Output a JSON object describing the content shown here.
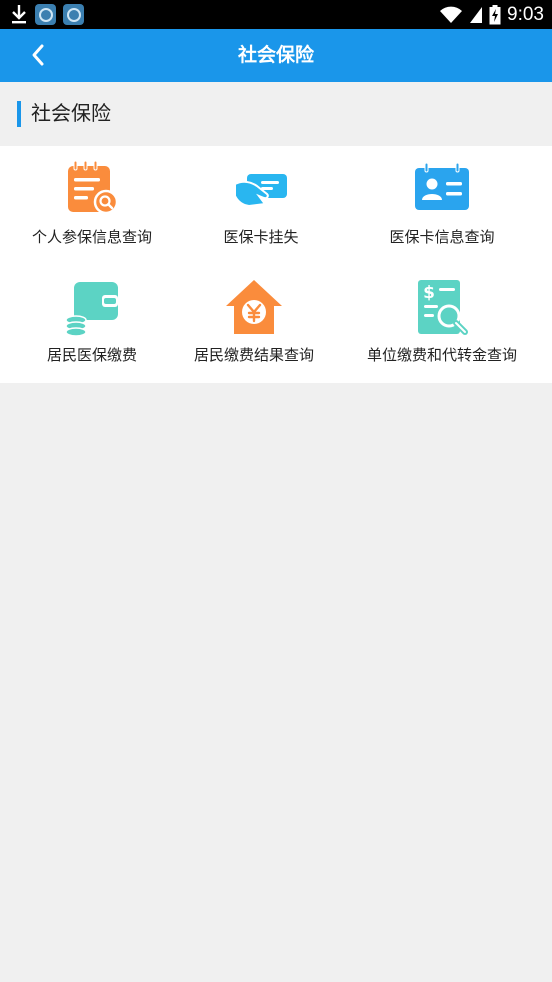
{
  "status_bar": {
    "time": "9:03",
    "icons": [
      "download-icon",
      "app-notification-icon",
      "app-notification-icon",
      "wifi-icon",
      "signal-icon",
      "battery-charging-icon"
    ]
  },
  "header": {
    "title": "社会保险",
    "back_icon": "chevron-left-icon"
  },
  "section": {
    "title": "社会保险"
  },
  "services": [
    {
      "label": "个人参保信息查询",
      "icon": "document-search-icon",
      "color": "#fa8c3c"
    },
    {
      "label": "医保卡挂失",
      "icon": "card-in-hand-icon",
      "color": "#29b6f0"
    },
    {
      "label": "医保卡信息查询",
      "icon": "id-card-icon",
      "color": "#2aa4ee"
    },
    {
      "label": "居民医保缴费",
      "icon": "wallet-coins-icon",
      "color": "#5cd3c4"
    },
    {
      "label": "居民缴费结果查询",
      "icon": "house-yen-icon",
      "color": "#fa8c3c"
    },
    {
      "label": "单位缴费和代转金查询",
      "icon": "dollar-document-search-icon",
      "color": "#5cd3c4"
    }
  ],
  "colors": {
    "primary": "#1a96ea",
    "background": "#f0f0f0"
  }
}
